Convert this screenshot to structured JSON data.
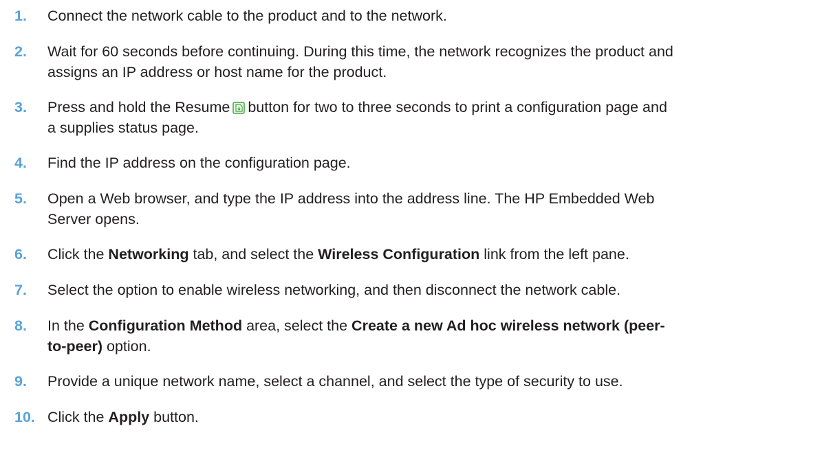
{
  "steps": [
    {
      "number": "1.",
      "text": "Connect the network cable to the product and to the network."
    },
    {
      "number": "2.",
      "line1": "Wait for 60 seconds before continuing. During this time, the network recognizes the product and",
      "line2": "assigns an IP address or host name for the product."
    },
    {
      "number": "3.",
      "before": "Press and hold the Resume",
      "after": "button for two to three seconds to print a configuration page and",
      "line2": "a supplies status page."
    },
    {
      "number": "4.",
      "text": "Find the IP address on the configuration page."
    },
    {
      "number": "5.",
      "line1": "Open a Web browser, and type the IP address into the address line. The HP Embedded Web",
      "line2": "Server opens."
    },
    {
      "number": "6.",
      "t1": "Click the ",
      "b1": "Networking",
      "t2": " tab, and select the ",
      "b2": "Wireless Configuration",
      "t3": " link from the left pane."
    },
    {
      "number": "7.",
      "text": "Select the option to enable wireless networking, and then disconnect the network cable."
    },
    {
      "number": "8.",
      "t1": "In the ",
      "b1": "Configuration Method",
      "t2": " area, select the ",
      "b2": "Create a new Ad hoc wireless network (peer-",
      "b3": "to-peer)",
      "t3": " option."
    },
    {
      "number": "9.",
      "text": "Provide a unique network name, select a channel, and select the type of security to use."
    },
    {
      "number": "10.",
      "t1": "Click the ",
      "b1": "Apply",
      "t2": " button."
    }
  ],
  "icons": {
    "resume": "resume-button-icon"
  },
  "colors": {
    "step_number": "#5aa3d8",
    "text": "#231f20",
    "icon_green": "#3aaa35"
  }
}
